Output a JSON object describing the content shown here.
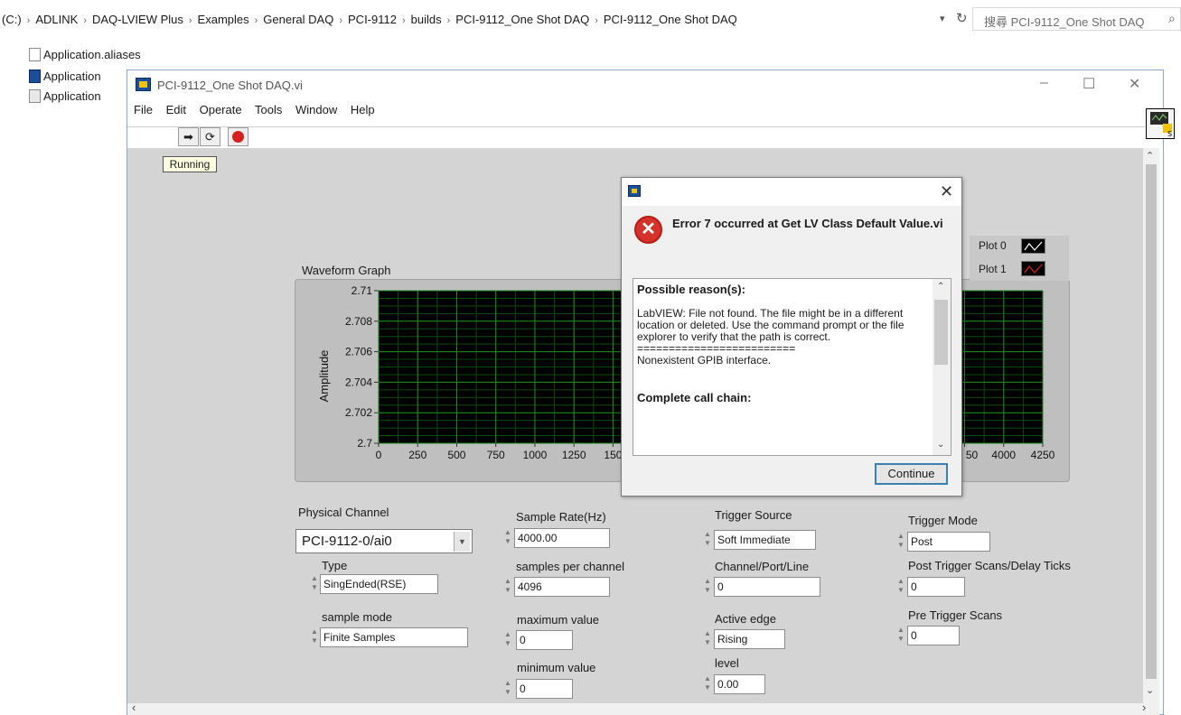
{
  "explorer": {
    "breadcrumb": [
      "(C:)",
      "ADLINK",
      "DAQ-LVIEW Plus",
      "Examples",
      "General DAQ",
      "PCI-9112",
      "builds",
      "PCI-9112_One Shot DAQ",
      "PCI-9112_One Shot DAQ"
    ],
    "search_placeholder": "搜尋 PCI-9112_One Shot DAQ",
    "files": [
      "Application.aliases",
      "Application",
      "Application"
    ]
  },
  "window": {
    "title": "PCI-9112_One Shot DAQ.vi",
    "menu": [
      "File",
      "Edit",
      "Operate",
      "Tools",
      "Window",
      "Help"
    ],
    "status": "Running"
  },
  "graph": {
    "label": "Waveform Graph",
    "legend": [
      {
        "name": "Plot 0",
        "color": "#ffffff"
      },
      {
        "name": "Plot 1",
        "color": "#e02020"
      }
    ]
  },
  "chart_data": {
    "type": "line",
    "title": "Waveform Graph",
    "xlabel": "",
    "ylabel": "Amplitude",
    "xlim": [
      0,
      4250
    ],
    "ylim": [
      2.7,
      2.71
    ],
    "x_ticks": [
      "0",
      "250",
      "500",
      "750",
      "1000",
      "1250",
      "150",
      "50",
      "4000",
      "4250"
    ],
    "y_ticks": [
      "2.71",
      "2.708",
      "2.706",
      "2.704",
      "2.702",
      "2.7"
    ],
    "grid": true,
    "series": [
      {
        "name": "Plot 0",
        "values": []
      },
      {
        "name": "Plot 1",
        "values": []
      }
    ]
  },
  "controls": {
    "physical_channel": {
      "label": "Physical Channel",
      "value": "PCI-9112-0/ai0"
    },
    "type": {
      "label": "Type",
      "value": "SingEnded(RSE)"
    },
    "sample_mode": {
      "label": "sample mode",
      "value": "Finite Samples"
    },
    "sample_rate": {
      "label": "Sample Rate(Hz)",
      "value": "4000.00"
    },
    "samples_per_channel": {
      "label": "samples per channel",
      "value": "4096"
    },
    "maximum_value": {
      "label": "maximum value",
      "value": "0"
    },
    "minimum_value": {
      "label": "minimum value",
      "value": "0"
    },
    "trigger_source": {
      "label": "Trigger Source",
      "value": "Soft Immediate"
    },
    "channel_port_line": {
      "label": "Channel/Port/Line",
      "value": "0"
    },
    "active_edge": {
      "label": "Active edge",
      "value": "Rising"
    },
    "level": {
      "label": "level",
      "value": "0.00"
    },
    "trigger_mode": {
      "label": "Trigger Mode",
      "value": "Post"
    },
    "post_trigger": {
      "label": "Post Trigger Scans/Delay Ticks",
      "value": "0"
    },
    "pre_trigger": {
      "label": "Pre Trigger Scans",
      "value": "0"
    }
  },
  "dialog": {
    "title": "Error 7 occurred at Get LV Class Default Value.vi",
    "reason_heading": "Possible reason(s):",
    "reason_text": "LabVIEW:  File not found. The file might be in a different location or deleted. Use the command prompt or the file explorer to verify that the path is correct.",
    "separator": "=========================",
    "reason_text2": "Nonexistent GPIB interface.",
    "chain_heading": "Complete call chain:",
    "continue_label": "Continue"
  }
}
